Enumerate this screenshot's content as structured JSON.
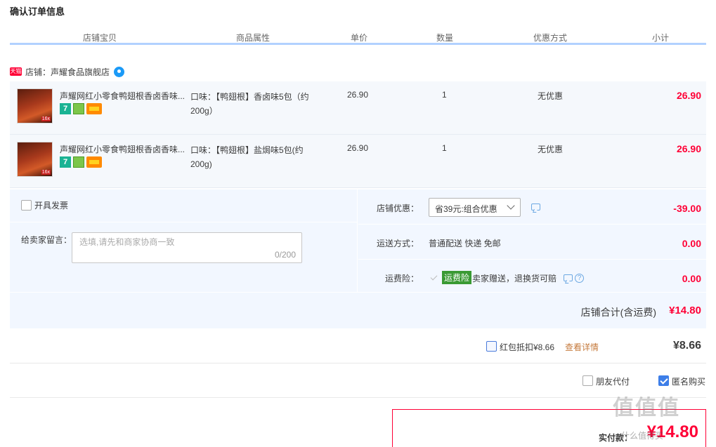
{
  "page": {
    "title": "确认订单信息"
  },
  "columns": [
    "店铺宝贝",
    "商品属性",
    "单价",
    "数量",
    "优惠方式",
    "小计"
  ],
  "shop": {
    "badge": "天猫",
    "label": "店铺：声耀食品旗舰店"
  },
  "items": [
    {
      "title": "声耀网红小零食鸭翅根香卤香味...",
      "attr": "口味：【鸭翅根】香卤味5包（约200g）",
      "price": "26.90",
      "qty": "1",
      "promo": "无优惠",
      "subtotal": "26.90"
    },
    {
      "title": "声耀网红小零食鸭翅根香卤香味...",
      "attr": "口味：【鸭翅根】盐焗味5包(约200g)",
      "price": "26.90",
      "qty": "1",
      "promo": "无优惠",
      "subtotal": "26.90"
    }
  ],
  "invoice": {
    "label": "开具发票"
  },
  "message": {
    "label": "给卖家留言：",
    "placeholder": "选填,请先和商家协商一致",
    "count": "0/200"
  },
  "shop_discount": {
    "label": "店铺优惠：",
    "selected": "省39元:组合优惠",
    "amount": "-39.00"
  },
  "shipping": {
    "label": "运送方式：",
    "value": "普通配送 快递 免邮",
    "amount": "0.00"
  },
  "insurance": {
    "label": "运费险：",
    "tag": "运费险",
    "text": "卖家赠送，退换货可赔",
    "help": "?",
    "amount": "0.00"
  },
  "shop_total": {
    "label": "店铺合计(含运费)",
    "amount": "¥14.80"
  },
  "red_packet": {
    "label": "红包抵扣¥8.66",
    "link": "查看详情",
    "amount": "¥8.66"
  },
  "options": {
    "friend_pay": "朋友代付",
    "anonymous": "匿名购买",
    "anonymous_checked": true
  },
  "payment": {
    "label": "实付款：",
    "amount": "¥14.80"
  },
  "watermark": {
    "logo": "值值值",
    "site": "什么值得买"
  },
  "colors": {
    "accent_red": "#ff0036",
    "panel_bg": "#f2f7ff",
    "header_line": "#b2d1ff",
    "insurance_green": "#3a9a34",
    "checkbox_blue": "#3d7ee8"
  }
}
